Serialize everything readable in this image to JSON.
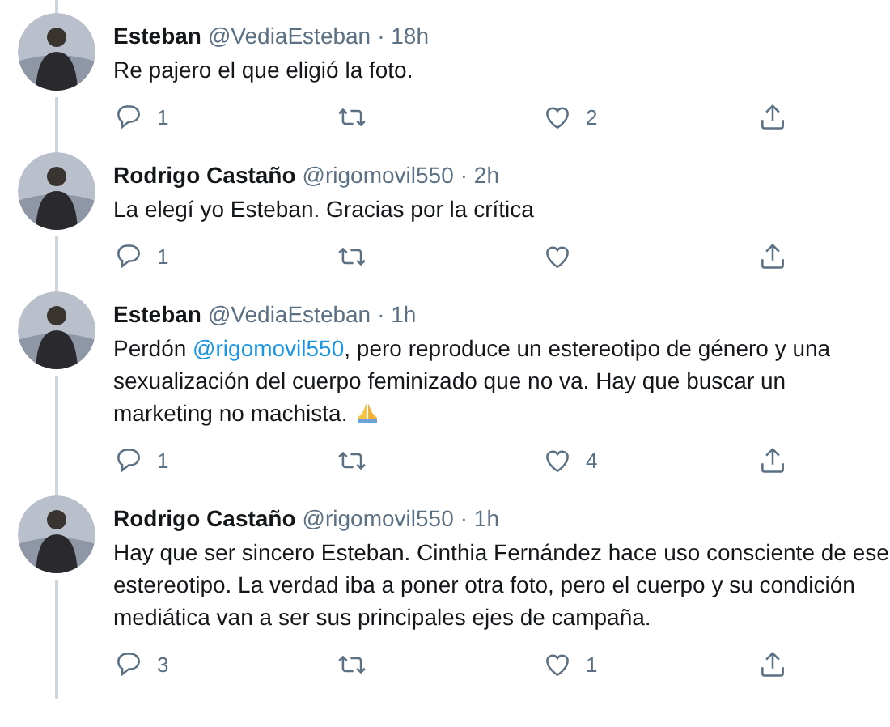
{
  "tweets": [
    {
      "avatar": {
        "kind": "picture"
      },
      "name": "Esteban",
      "handle": "@VediaEsteban",
      "time": "· 18h",
      "body": [
        [
          {
            "kind": "text",
            "text": "Re pajero el que eligió la foto."
          }
        ]
      ],
      "replies": "1",
      "likes": "2"
    },
    {
      "avatar": {
        "kind": "picture"
      },
      "name": "Rodrigo Castaño",
      "handle": "@rigomovil550",
      "time": "· 2h",
      "body": [
        [
          {
            "kind": "text",
            "text": "La elegí yo Esteban. Gracias por la crítica"
          }
        ]
      ],
      "replies": "1"
    },
    {
      "avatar": {
        "kind": "picture"
      },
      "name": "Esteban",
      "handle": "@VediaEsteban",
      "time": "· 1h",
      "body": [
        [
          {
            "kind": "text",
            "text": "Perdón "
          },
          {
            "kind": "mention",
            "text": "@rigomovil550"
          },
          {
            "kind": "text",
            "text": ", pero reproduce un estereotipo de género y una"
          }
        ],
        [
          {
            "kind": "text",
            "text": "sexualización del cuerpo feminizado que no va. Hay que buscar un"
          }
        ],
        [
          {
            "kind": "text",
            "text": "marketing no machista. "
          },
          {
            "kind": "emoji"
          }
        ]
      ],
      "replies": "1",
      "likes": "4"
    },
    {
      "avatar": {
        "kind": "picture"
      },
      "name": "Rodrigo Castaño",
      "handle": "@rigomovil550",
      "time": "· 1h",
      "body": [
        [
          {
            "kind": "text",
            "text": "Hay que ser sincero Esteban. Cinthia Fernández hace uso consciente de ese"
          }
        ],
        [
          {
            "kind": "text",
            "text": "estereotipo. La verdad iba a poner otra foto, pero el cuerpo y su condición"
          }
        ],
        [
          {
            "kind": "text",
            "text": "mediática van a ser sus principales ejes de campaña."
          }
        ]
      ],
      "replies": "3",
      "likes": "1"
    }
  ]
}
